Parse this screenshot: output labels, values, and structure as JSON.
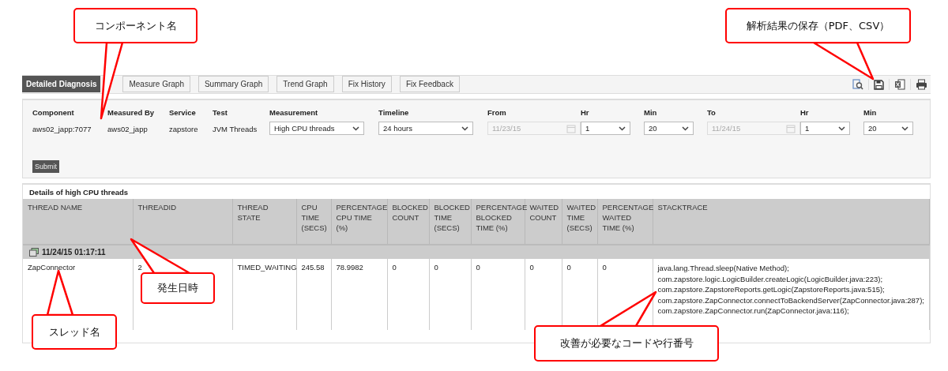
{
  "tabs": [
    {
      "label": "Detailed Diagnosis",
      "selected": true
    },
    {
      "label": "Measure Graph",
      "selected": false
    },
    {
      "label": "Summary Graph",
      "selected": false
    },
    {
      "label": "Trend Graph",
      "selected": false
    },
    {
      "label": "Fix History",
      "selected": false
    },
    {
      "label": "Fix Feedback",
      "selected": false
    }
  ],
  "form": {
    "fields": [
      {
        "kind": "static",
        "label": "Component",
        "value": "aws02_japp:7077"
      },
      {
        "kind": "static",
        "label": "Measured By",
        "value": "aws02_japp"
      },
      {
        "kind": "static",
        "label": "Service",
        "value": "zapstore"
      },
      {
        "kind": "static",
        "label": "Test",
        "value": "JVM Threads"
      },
      {
        "kind": "select",
        "label": "Measurement",
        "value": "High CPU threads",
        "disabled": false
      },
      {
        "kind": "select",
        "label": "Timeline",
        "value": "24 hours",
        "disabled": false
      },
      {
        "kind": "date",
        "label": "From",
        "value": "11/23/15",
        "disabled": true
      },
      {
        "kind": "select",
        "label": "Hr",
        "value": "1",
        "disabled": false
      },
      {
        "kind": "select",
        "label": "Min",
        "value": "20",
        "disabled": false
      },
      {
        "kind": "date",
        "label": "To",
        "value": "11/24/15",
        "disabled": true
      },
      {
        "kind": "select",
        "label": "Hr",
        "value": "1",
        "disabled": false
      },
      {
        "kind": "select",
        "label": "Min",
        "value": "20",
        "disabled": false
      }
    ],
    "submit": "Submit"
  },
  "table": {
    "title": "Details of high CPU threads",
    "columns": [
      "THREAD NAME",
      "THREADID",
      "THREAD STATE",
      "CPU TIME (SECS)",
      "PERCENTAGE CPU TIME (%)",
      "BLOCKED COUNT",
      "BLOCKED TIME (SECS)",
      "PERCENTAGE BLOCKED TIME (%)",
      "WAITED COUNT",
      "WAITED TIME (SECS)",
      "PERCENTAGE WAITED TIME (%)",
      "STACKTRACE"
    ],
    "group": "11/24/15 01:17:11",
    "rows": [
      {
        "cells": [
          "ZapConnector",
          "2",
          "TIMED_WAITING",
          "245.58",
          "78.9982",
          "0",
          "0",
          "0",
          "0",
          "0",
          "0"
        ],
        "stacktrace": [
          "java.lang.Thread.sleep(Native Method);",
          "com.zapstore.logic.LogicBuilder.createLogic(LogicBuilder.java:223);",
          "com.zapstore.ZapstoreReports.getLogic(ZapstoreReports.java:515);",
          "com.zapstore.ZapConnector.connectToBackendServer(ZapConnector.java:287);",
          "com.zapstore.ZapConnector.run(ZapConnector.java:116);"
        ]
      }
    ]
  },
  "callouts": [
    {
      "text": "コンポーネント名"
    },
    {
      "text": "解析結果の保存（PDF、CSV）"
    },
    {
      "text": "発生日時"
    },
    {
      "text": "スレッド名"
    },
    {
      "text": "改善が必要なコードや行番号"
    }
  ]
}
